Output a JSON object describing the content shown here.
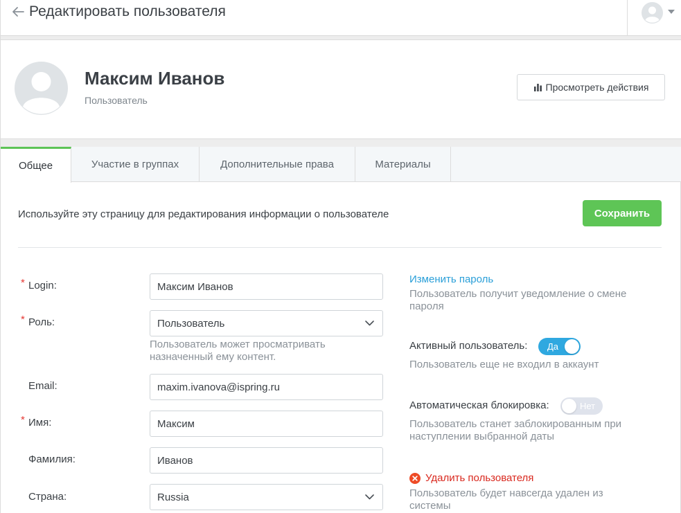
{
  "topbar": {
    "title": "Редактировать пользователя",
    "back_icon": "arrow-left-icon",
    "profile_icon": "user-avatar-icon",
    "menu_icon": "caret-down-icon"
  },
  "header": {
    "name": "Максим Иванов",
    "role": "Пользователь",
    "avatar_icon": "user-avatar-icon",
    "actions_button_label": "Просмотреть действия",
    "actions_button_icon": "bar-chart-icon"
  },
  "tabs": [
    {
      "label": "Общее",
      "active": true
    },
    {
      "label": "Участие в группах",
      "active": false
    },
    {
      "label": "Дополнительные права",
      "active": false
    },
    {
      "label": "Материалы",
      "active": false
    }
  ],
  "main": {
    "intro": "Используйте эту страницу для редактирования информации о пользователе",
    "save_label": "Сохранить"
  },
  "form": {
    "login": {
      "label": "Login:",
      "value": "Максим Иванов",
      "required": "*"
    },
    "role": {
      "label": "Роль:",
      "value": "Пользователь",
      "required": "*",
      "hint": "Пользователь может просматривать назначенный ему контент."
    },
    "email": {
      "label": "Email:",
      "value": "maxim.ivanova@ispring.ru"
    },
    "first_name": {
      "label": "Имя:",
      "value": "Максим",
      "required": "*"
    },
    "last_name": {
      "label": "Фамилия:",
      "value": "Иванов"
    },
    "country": {
      "label": "Страна:",
      "value": "Russia"
    }
  },
  "side": {
    "change_password_link": "Изменить пароль",
    "change_password_hint": "Пользователь получит уведомление о смене пароля",
    "active_label": "Активный пользователь:",
    "active_toggle": "Да",
    "active_hint": "Пользователь еще не входил в аккаунт",
    "autoblock_label": "Автоматическая блокировка:",
    "autoblock_toggle": "Нет",
    "autoblock_hint": "Пользователь станет заблокированным при наступлении выбранной даты",
    "delete_link": "Удалить пользователя",
    "delete_icon": "close-circle-icon",
    "delete_hint": "Пользователь будет навсегда удален из системы"
  },
  "colors": {
    "accent_green": "#5ec556",
    "toggle_blue": "#2fa8e0",
    "link_blue": "#2a9fd8",
    "danger_red": "#d9281e"
  }
}
